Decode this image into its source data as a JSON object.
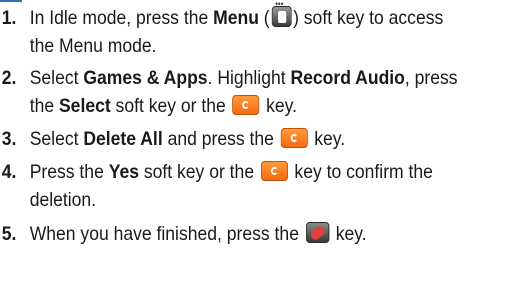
{
  "steps": [
    {
      "number": "1.",
      "line1_a": "In Idle mode, press the ",
      "line1_b": "Menu",
      "line1_c": " (",
      "line1_d": ") soft key to access",
      "line2": "the Menu mode."
    },
    {
      "number": "2.",
      "line1_a": "Select ",
      "line1_b": "Games & Apps",
      "line1_c": ". Highlight ",
      "line1_d": "Record Audio",
      "line1_e": ", press",
      "line2_a": "the ",
      "line2_b": "Select",
      "line2_c": " soft key or the ",
      "line2_d": " key."
    },
    {
      "number": "3.",
      "line1_a": "Select ",
      "line1_b": "Delete All",
      "line1_c": " and press the ",
      "line1_d": " key."
    },
    {
      "number": "4.",
      "line1_a": "Press the ",
      "line1_b": "Yes",
      "line1_c": " soft key or the ",
      "line1_d": " key to confirm the",
      "line2": "deletion."
    },
    {
      "number": "5.",
      "line1_a": "When you have finished, press the ",
      "line1_b": " key."
    }
  ],
  "icons": {
    "menu_key": "menu-soft-key-icon",
    "ok_key": "ok-select-key-icon",
    "end_key": "end-power-key-icon"
  },
  "colors": {
    "ok_key": "#f26a12",
    "accent_bar": "#2f6fb5",
    "end_key_glyph": "#e0403a"
  }
}
